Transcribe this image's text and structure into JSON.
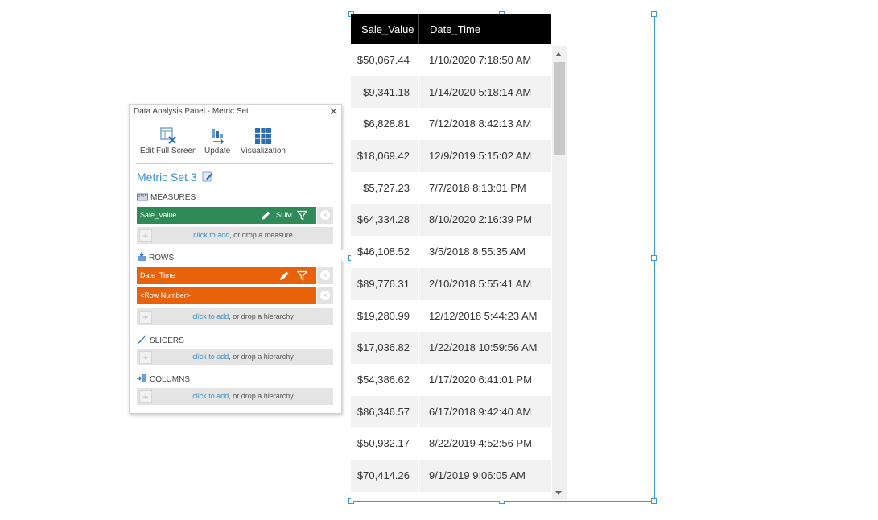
{
  "panel": {
    "title": "Data Analysis Panel - Metric Set",
    "close": "✕",
    "toolbar": [
      {
        "label": "Edit Full Screen",
        "icon": "edit-full-screen-icon"
      },
      {
        "label": "Update",
        "icon": "update-icon"
      },
      {
        "label": "Visualization",
        "icon": "visualization-grid-icon"
      }
    ],
    "metric_set_title": "Metric Set 3",
    "measures": {
      "heading": "MEASURES",
      "items": [
        {
          "label": "Sale_Value",
          "aggregation": "SUM"
        }
      ],
      "drop_link": "click to add",
      "drop_rest": ", or drop a measure"
    },
    "rows": {
      "heading": "ROWS",
      "items": [
        {
          "label": "Date_Time"
        },
        {
          "label": "<Row Number>"
        }
      ],
      "drop_link": "click to add",
      "drop_rest": ", or drop a hierarchy"
    },
    "slicers": {
      "heading": "SLICERS",
      "drop_link": "click to add",
      "drop_rest": ", or drop a hierarchy"
    },
    "columns": {
      "heading": "COLUMNS",
      "drop_link": "click to add",
      "drop_rest": ", or drop a hierarchy"
    },
    "plus": "+",
    "remove": "×"
  },
  "table": {
    "headers": [
      "Sale_Value",
      "Date_Time"
    ],
    "rows": [
      [
        "$50,067.44",
        "1/10/2020 7:18:50 AM"
      ],
      [
        "$9,341.18",
        "1/14/2020 5:18:14 AM"
      ],
      [
        "$6,828.81",
        "7/12/2018 8:42:13 AM"
      ],
      [
        "$18,069.42",
        "12/9/2019 5:15:02 AM"
      ],
      [
        "$5,727.23",
        "7/7/2018 8:13:01 PM"
      ],
      [
        "$64,334.28",
        "8/10/2020 2:16:39 PM"
      ],
      [
        "$46,108.52",
        "3/5/2018 8:55:35 AM"
      ],
      [
        "$89,776.31",
        "2/10/2018 5:55:41 AM"
      ],
      [
        "$19,280.99",
        "12/12/2018 5:44:23 AM"
      ],
      [
        "$17,036.82",
        "1/22/2018 10:59:56 AM"
      ],
      [
        "$54,386.62",
        "1/17/2020 6:41:01 PM"
      ],
      [
        "$86,346.57",
        "6/17/2018 9:42:40 AM"
      ],
      [
        "$50,932.17",
        "8/22/2019 4:52:56 PM"
      ],
      [
        "$70,414.26",
        "9/1/2019 9:06:05 AM"
      ]
    ]
  },
  "colors": {
    "measure_chip": "#2e8b57",
    "row_chip": "#e8620b",
    "link": "#3a8fc9",
    "selection": "#3a9ad9",
    "header_bg": "#000000"
  }
}
